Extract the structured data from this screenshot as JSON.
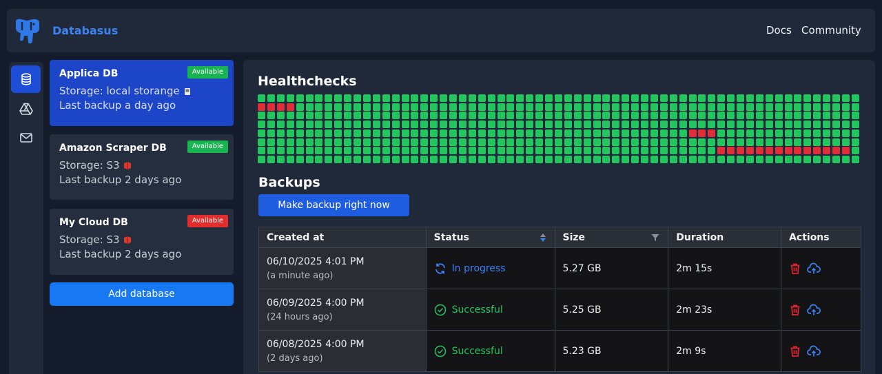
{
  "header": {
    "brand": "Databasus",
    "links": {
      "docs": "Docs",
      "community": "Community"
    }
  },
  "nav": {
    "icons": [
      "database-icon",
      "drive-icon",
      "mail-icon"
    ]
  },
  "databases": [
    {
      "name": "Applica DB",
      "badge": "Available",
      "badge_color": "#19b452",
      "storage": "Storage: local storange",
      "last_backup": "Last backup a day ago",
      "selected": true
    },
    {
      "name": "Amazon Scraper DB",
      "badge": "Available",
      "badge_color": "#19b452",
      "storage": "Storage: S3",
      "last_backup": "Last backup 2 days ago",
      "selected": false
    },
    {
      "name": "My Cloud DB",
      "badge": "Available",
      "badge_color": "#e32c2c",
      "storage": "Storage: S3",
      "last_backup": "Last backup 2 days ago",
      "selected": false
    }
  ],
  "add_database_label": "Add database",
  "healthchecks": {
    "title": "Healthchecks",
    "rows": 8,
    "cols": 63,
    "failed_cells": [
      [
        1,
        0
      ],
      [
        1,
        1
      ],
      [
        1,
        2
      ],
      [
        1,
        3
      ],
      [
        4,
        45
      ],
      [
        4,
        46
      ],
      [
        4,
        47
      ],
      [
        6,
        48
      ],
      [
        6,
        49
      ],
      [
        6,
        50
      ],
      [
        6,
        51
      ],
      [
        6,
        52
      ],
      [
        6,
        53
      ],
      [
        6,
        54
      ],
      [
        6,
        55
      ],
      [
        6,
        56
      ],
      [
        6,
        57
      ],
      [
        6,
        58
      ],
      [
        6,
        59
      ],
      [
        6,
        60
      ],
      [
        6,
        61
      ]
    ],
    "colors": {
      "ok": "#23c55e",
      "fail": "#e12d39"
    }
  },
  "backups": {
    "title": "Backups",
    "make_backup_label": "Make backup right now",
    "columns": [
      "Created at",
      "Status",
      "Size",
      "Duration",
      "Actions"
    ],
    "rows": [
      {
        "created": "06/10/2025 4:01 PM",
        "created_rel": "(a minute ago)",
        "status": "In progress",
        "status_kind": "progress",
        "size": "5.27 GB",
        "duration": "2m 15s"
      },
      {
        "created": "06/09/2025 4:00 PM",
        "created_rel": "(24 hours ago)",
        "status": "Successful",
        "status_kind": "success",
        "size": "5.25 GB",
        "duration": "2m 23s"
      },
      {
        "created": "06/08/2025 4:00 PM",
        "created_rel": "(2 days ago)",
        "status": "Successful",
        "status_kind": "success",
        "size": "5.23 GB",
        "duration": "2m 9s"
      }
    ]
  }
}
